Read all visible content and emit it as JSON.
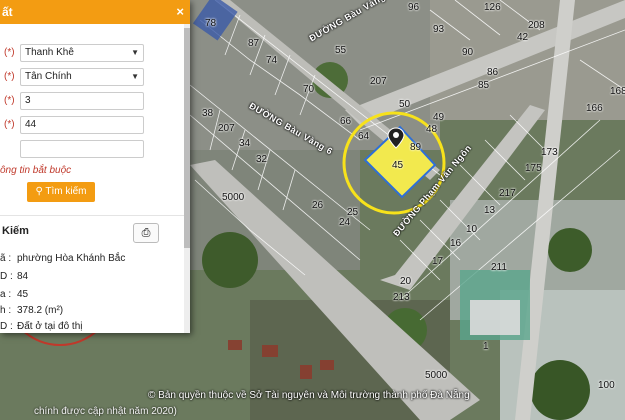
{
  "panel": {
    "title": "ất",
    "close_label": "×",
    "fields": [
      {
        "required": "(*)",
        "value": "Thanh Khê",
        "type": "select"
      },
      {
        "required": "(*)",
        "value": "Tân Chính",
        "type": "select"
      },
      {
        "required": "(*)",
        "value": "3",
        "type": "text"
      },
      {
        "required": "(*)",
        "value": "44",
        "type": "text"
      },
      {
        "required": "",
        "value": "",
        "type": "text"
      }
    ],
    "required_hint": "ông tin bắt buộc",
    "search_label": "Tìm kiếm",
    "results_title": "Kiếm",
    "print_icon": "print-icon",
    "results": [
      {
        "key": "ã :",
        "value": "phường Hòa Khánh Bắc"
      },
      {
        "key": "D :",
        "value": "84"
      },
      {
        "key": "a :",
        "value": "45"
      },
      {
        "key": "h :",
        "value": "378.2 (m²)"
      },
      {
        "key": "D :",
        "value": "Đất ở tại đô thị"
      }
    ]
  },
  "map": {
    "streets": [
      "ĐƯỜNG Bàu Vàng 6",
      "ĐƯỜNG Bàu Vàng 6",
      "ĐƯỜNG Phạm Văn Ngôn"
    ],
    "parcels": [
      "78",
      "87",
      "74",
      "55",
      "96",
      "126",
      "208",
      "93",
      "42",
      "90",
      "86",
      "85",
      "207",
      "70",
      "50",
      "49",
      "48",
      "66",
      "64",
      "89",
      "45",
      "173",
      "168",
      "166",
      "38",
      "207",
      "34",
      "32",
      "5000",
      "26",
      "25",
      "24",
      "217",
      "175",
      "13",
      "10",
      "16",
      "17",
      "211",
      "20",
      "213",
      "1",
      "5000",
      "100"
    ],
    "marker_icon": "map-pin-icon",
    "highlight_color": "#f2e94e",
    "copyright": "© Bản quyền thuộc về Sở Tài nguyên và Môi trường thành phố Đà Nẵng",
    "updated": "chính được cập nhật năm 2020)"
  }
}
